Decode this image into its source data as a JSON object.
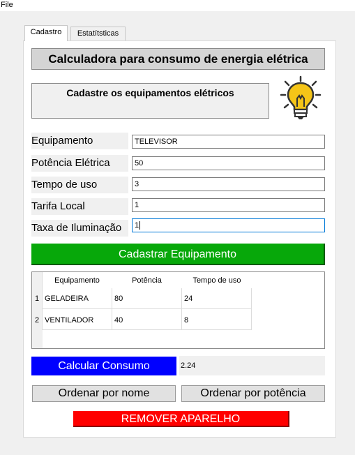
{
  "menu": {
    "file": "File"
  },
  "tabs": [
    {
      "label": "Cadastro",
      "active": true
    },
    {
      "label": "Estatítsticas",
      "active": false
    }
  ],
  "header": {
    "title": "Calculadora para consumo de energia elétrica",
    "subtitle": "Cadastre os equipamentos elétricos",
    "icon": "lightbulb-icon"
  },
  "form": {
    "equipamento": {
      "label": "Equipamento",
      "value": "TELEVISOR"
    },
    "potencia": {
      "label": "Potência Elétrica",
      "value": "50"
    },
    "tempo": {
      "label": "Tempo de uso",
      "value": "3"
    },
    "tarifa": {
      "label": "Tarifa Local",
      "value": "1"
    },
    "taxa": {
      "label": "Taxa de Iluminação",
      "value": "1"
    }
  },
  "buttons": {
    "cadastrar": "Cadastrar Equipamento",
    "calcular": "Calcular Consumo",
    "ordenar_nome": "Ordenar por nome",
    "ordenar_potencia": "Ordenar por potência",
    "remover": "REMOVER APARELHO"
  },
  "table": {
    "headers": [
      "Equipamento",
      "Potência",
      "Tempo de uso"
    ],
    "rows": [
      {
        "index": "1",
        "cells": [
          "GELADEIRA",
          "80",
          "24"
        ]
      },
      {
        "index": "2",
        "cells": [
          "VENTILADOR",
          "40",
          "8"
        ]
      }
    ]
  },
  "result": {
    "value": "2.24"
  },
  "colors": {
    "green_button": "#07a80a",
    "blue_button": "#0000ff",
    "red_button": "#ff0000",
    "bulb": "#f5c518"
  }
}
